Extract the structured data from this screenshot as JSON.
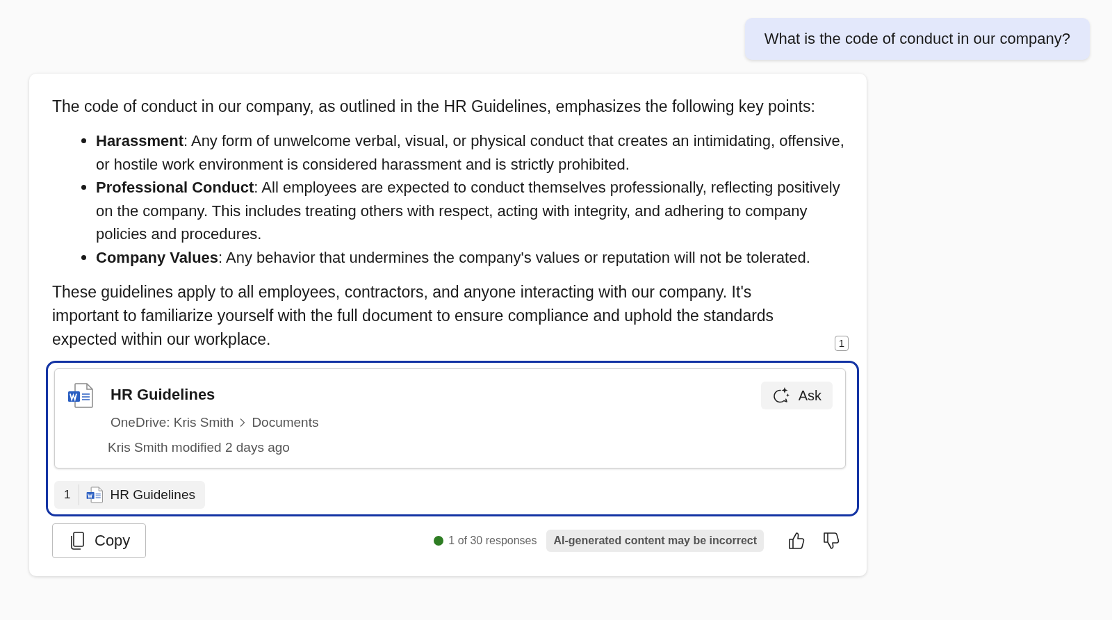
{
  "user_message": {
    "text": "What is the code of conduct in our company?"
  },
  "response": {
    "intro": "The code of conduct in our company, as outlined in the HR Guidelines, emphasizes the following key points:",
    "bullets": [
      {
        "text": "**Harassment**: Any form of unwelcome verbal, visual, or physical conduct that creates an intimidating, offensive, or hostile work environment is considered harassment and is strictly prohibited."
      },
      {
        "text": "**Professional Conduct**: All employees are expected to conduct themselves professionally, reflecting positively on the company. This includes treating others with respect, acting with integrity, and adhering to company policies and procedures."
      },
      {
        "text": "**Company Values**: Any behavior that undermines the company's values or reputation will not be tolerated."
      }
    ],
    "closing": "These guidelines apply to all employees, contractors, and anyone interacting with our company. It's important to familiarize yourself with the full document to ensure compliance and uphold the standards expected within our workplace.",
    "citation_mark": "1"
  },
  "source_panel": {
    "focused": true,
    "card": {
      "title": "HR Guidelines",
      "location": "OneDrive: Kris Smith",
      "folder": "Documents",
      "modified": "Kris Smith modified 2 days ago",
      "ask_button": "Ask"
    },
    "citations": [
      {
        "number": "1",
        "title": "HR Guidelines"
      }
    ]
  },
  "footer": {
    "copy_button": "Copy",
    "response_count": "1 of 30 responses",
    "disclaimer": "AI-generated content may be incorrect"
  }
}
